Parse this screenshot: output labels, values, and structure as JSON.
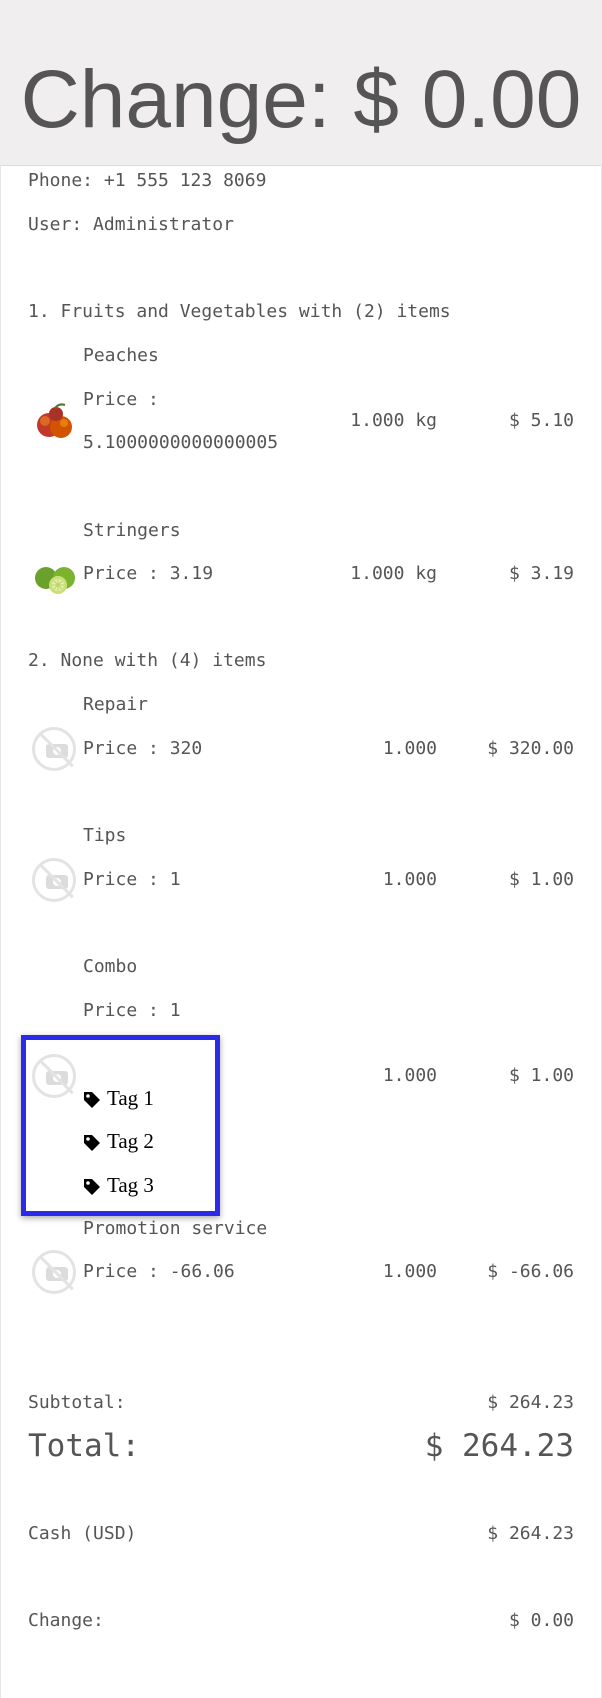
{
  "header": {
    "change_title": "Change: $ 0.00"
  },
  "receipt": {
    "phone": "Phone: +1 555 123 8069",
    "user": "User: Administrator",
    "groups": [
      {
        "title": "1. Fruits and Vegetables with (2) items",
        "items": [
          {
            "name": "Peaches",
            "price_line1": "Price :",
            "price_line2": "5.1000000000000005",
            "qty": "1.000 kg",
            "total": "$ 5.10",
            "image": "peaches-photo"
          },
          {
            "name": "Stringers",
            "price": "Price : 3.19",
            "qty": "1.000 kg",
            "total": "$ 3.19",
            "image": "limes-photo"
          }
        ]
      },
      {
        "title": "2. None with (4) items",
        "items": [
          {
            "name": "Repair",
            "price": "Price : 320",
            "qty": "1.000",
            "total": "$ 320.00",
            "image": "no-image-icon"
          },
          {
            "name": "Tips",
            "price": "Price : 1",
            "qty": "1.000",
            "total": "$ 1.00",
            "image": "no-image-icon"
          },
          {
            "name": "Combo",
            "price": "Price : 1",
            "qty": "1.000",
            "total": "$ 1.00",
            "image": "no-image-icon",
            "tags": [
              "Tag 1",
              "Tag 2",
              "Tag 3"
            ]
          },
          {
            "name": "Promotion service",
            "price": "Price : -66.06",
            "qty": "1.000",
            "total": "$ -66.06",
            "image": "no-image-icon"
          }
        ]
      }
    ],
    "subtotal_label": "Subtotal:",
    "subtotal_value": "$ 264.23",
    "total_label": "Total:",
    "total_value": "$ 264.23",
    "payment_label": "Cash (USD)",
    "payment_value": "$ 264.23",
    "change_label": "Change:",
    "change_value": "$ 0.00"
  },
  "colors": {
    "highlight": "#2a2ae8",
    "text": "#555555",
    "header_bg": "#f0eeee"
  }
}
